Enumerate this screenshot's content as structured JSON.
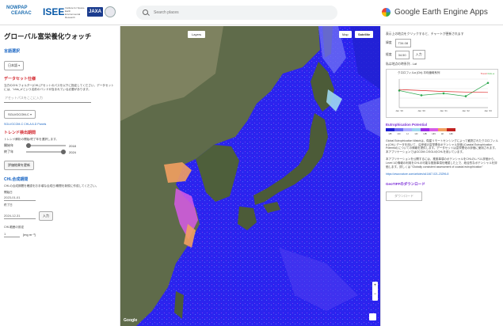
{
  "header": {
    "logo_nowpap_1": "NOWPAP",
    "logo_nowpap_2": "CEARAC",
    "logo_isee": "ISEE",
    "logo_text": "Institute for Space-Earth Environmental Research",
    "logo_jaxa": "JAXA",
    "search_placeholder": "Search places",
    "apps_title": "Google Earth Engine Apps"
  },
  "left": {
    "page_title": "グローバル富栄養化ウォッチ",
    "lang_section": "言語選択",
    "lang_value": "日本語",
    "dataset_section": "データセット仕様",
    "dataset_text": "当方のCHLフォルダー(CHL)アセットのパスを以下に指定してください。データセットには、\"chla_a\"という名前のバンドが含まれている必要があります。",
    "asset_placeholder": "アセットパスをここに入力",
    "asset_select": "SGLI/GCOM-C",
    "asset_link": "SGLI/GCOM-C CHLA 8-D Panels",
    "trend_section": "トレンド検出期間",
    "trend_text": "トレンド解析の開始/終了年を選択します。",
    "start_label": "開始年",
    "start_value": "2018",
    "end_label": "終了年",
    "end_value": "2024",
    "eval_button": "評価結果を更新",
    "chl_section": "CHL合成期間",
    "chl_text": "CHLの合成期間を確認をお手頃な合成日/期間を新規に作成してください。",
    "start_date_label": "開始日",
    "start_date": "2023-01-01",
    "end_date_label": "終了日",
    "end_date": "2024-12-31",
    "input_button": "入力",
    "chl_threshold_label": "CHL範囲の設定",
    "chl_threshold_value": "1",
    "chl_unit": "[mg m⁻³]"
  },
  "map": {
    "layers_label": "Layers",
    "map_label": "Map",
    "satellite_label": "Satellite",
    "watermark": "Google",
    "zoom_in": "+",
    "zoom_out": "−"
  },
  "right": {
    "intro": "表示上の地点をクリックすると、チャートが更新されます",
    "lat_label": "緯度",
    "lat_value": "T34.08",
    "lon_label": "経度",
    "lon_value": "34.50",
    "apply_button": "入力",
    "chart_section": "私は地点の時系列 - Lat",
    "chart_title": "クロロフィルa (Chl) 平均値時系列",
    "ep_title": "Eutrophication Potential",
    "ep_labels": [
      "LB",
      "LN",
      "LI",
      "LD",
      "HB",
      "HN",
      "HI",
      "HD"
    ],
    "para1": "Global Eutrophication Watchは、衛星リモートセンシングによって観測されたクロロフィルa (CHL) データを用いて、沿岸域の富栄養化ポテンシャル評価 (Coastal Eutrophication Potential) についての情報を提供します。データセットは富栄養化の評価に使用されます。本アプリケーションではGCOM-C/SGLIのCHLを用いています。",
    "para2": "本アプリケーションを公開するには、推奨事項のポテンシャルをCHLのレベル評価から、Level 1の情報の利用をCHLの可能な推奨事項を確認した上で、総合的なポテンシャルを評価します。詳しくは \"Globally consistent assessment of coastal eutrophication\"",
    "para2_link": "https://www.nature.com/articles/s41467-021-23296-8",
    "dl_title": "GeoTIFFのダウンロード",
    "dl_button": "ダウンロード"
  },
  "colors": {
    "ep_colors": [
      "#2020d0",
      "#6d6df2",
      "#b0b0ff",
      "#9fd8f0",
      "#9a2be6",
      "#d75ae6",
      "#f2a060",
      "#c02020"
    ],
    "link": "#1a66c4",
    "eutrophication_title": "#7a2bd6"
  },
  "chart_data": {
    "type": "line",
    "title": "クロロフィルa (Chl) 平均値時系列",
    "x": [
      "Jan '19",
      "Jan '20",
      "Jan '21",
      "Jan '22",
      "Jan '23"
    ],
    "series": [
      {
        "name": "CHL-a",
        "values": [
          0.9,
          0.65,
          0.75,
          0.6,
          1.3
        ]
      },
      {
        "name": "Trend",
        "values": [
          0.95,
          0.9,
          0.85,
          0.82,
          0.8
        ]
      }
    ],
    "ylim": [
      0,
      1.5
    ],
    "legend": "top-right"
  }
}
